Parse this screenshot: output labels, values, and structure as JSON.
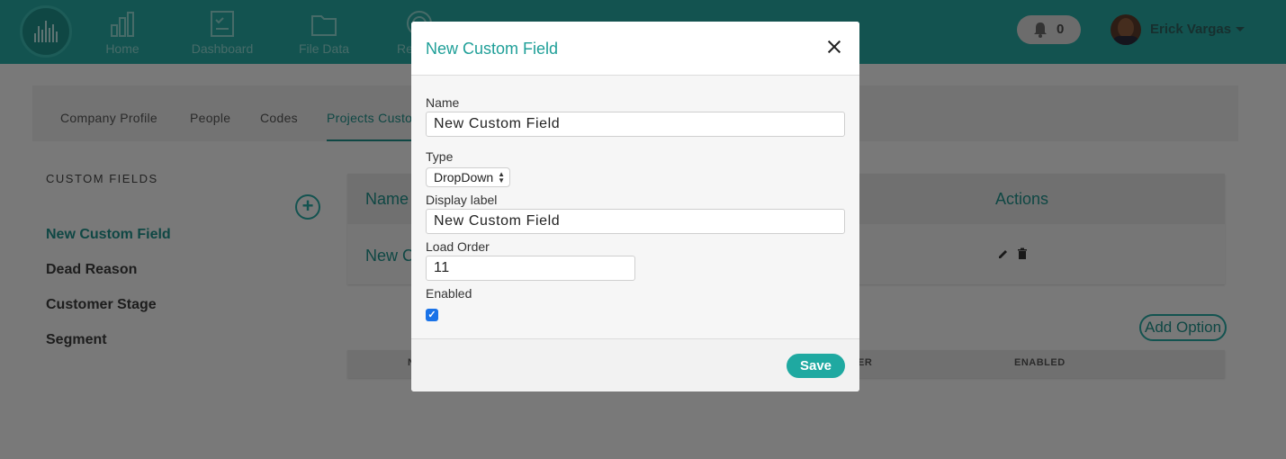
{
  "nav": {
    "items": [
      {
        "label": "Home",
        "icon": "bar-chart-icon"
      },
      {
        "label": "Dashboard",
        "icon": "clipboard-check-icon"
      },
      {
        "label": "File Data",
        "icon": "folder-icon"
      },
      {
        "label": "Re",
        "icon": "target-icon"
      }
    ],
    "notification_count": "0",
    "user_name": "Erick Vargas"
  },
  "tabs": [
    "Company Profile",
    "People",
    "Codes",
    "Projects Custo"
  ],
  "sidebar": {
    "title": "CUSTOM FIELDS",
    "items": [
      "New Custom Field",
      "Dead Reason",
      "Customer Stage",
      "Segment"
    ]
  },
  "table": {
    "header_name": "Name",
    "header_actions": "Actions",
    "row_name": "New C",
    "add_option": "Add Option",
    "options_headers": [
      "N",
      "ER",
      "ENABLED"
    ]
  },
  "modal": {
    "title": "New Custom Field",
    "name_label": "Name",
    "name_value": "New Custom Field",
    "type_label": "Type",
    "type_value": "DropDown",
    "display_label_label": "Display label",
    "display_label_value": "New Custom Field",
    "load_order_label": "Load Order",
    "load_order_value": "11",
    "enabled_label": "Enabled",
    "enabled_checked": true,
    "save_label": "Save"
  },
  "colors": {
    "brand_teal": "#27a7a1",
    "accent_text": "#1f9f98",
    "checkbox_blue": "#1a73e8"
  }
}
